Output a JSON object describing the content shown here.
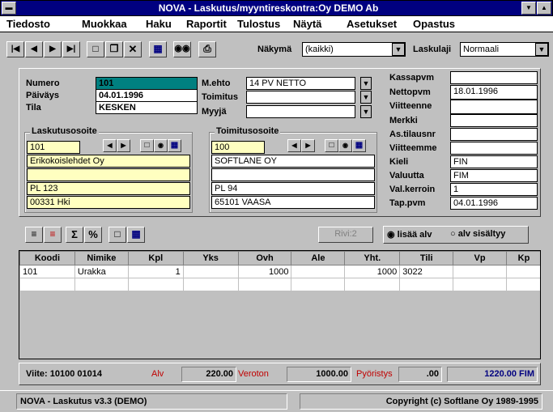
{
  "window": {
    "title": "NOVA - Laskutus/myyntireskontra:Oy DEMO Ab"
  },
  "menu": [
    "Tiedosto",
    "Muokkaa",
    "Haku",
    "Raportit",
    "Tulostus",
    "Näytä",
    "Asetukset",
    "Opastus"
  ],
  "toolbar": {
    "view_label": "Näkymä",
    "view_value": "(kaikki)",
    "type_label": "Laskulaji",
    "type_value": "Normaali"
  },
  "header": {
    "numero_label": "Numero",
    "numero": "101",
    "paivays_label": "Päiväys",
    "paivays": "04.01.1996",
    "tila_label": "Tila",
    "tila": "KESKEN",
    "mehto_label": "M.ehto",
    "mehto": "14 PV NETTO",
    "toimitus_label": "Toimitus",
    "toimitus": "",
    "myyja_label": "Myyjä",
    "myyja": ""
  },
  "billing": {
    "title": "Laskutusosoite",
    "code": "101",
    "lines": [
      "Erikokoislehdet Oy",
      "",
      "PL 123",
      "00331 Hki"
    ]
  },
  "delivery": {
    "title": "Toimitusosoite",
    "code": "100",
    "lines": [
      "SOFTLANE OY",
      "",
      "PL 94",
      "65101  VAASA"
    ]
  },
  "right": [
    {
      "label": "Kassapvm",
      "value": ""
    },
    {
      "label": "Nettopvm",
      "value": "18.01.1996"
    },
    {
      "label": "Viitteenne",
      "value": ""
    },
    {
      "label": "Merkki",
      "value": ""
    },
    {
      "label": "As.tilausnr",
      "value": ""
    },
    {
      "label": "Viitteemme",
      "value": ""
    },
    {
      "label": "Kieli",
      "value": "FIN"
    },
    {
      "label": "Valuutta",
      "value": "FIM"
    },
    {
      "label": "Val.kerroin",
      "value": "1"
    },
    {
      "label": "Tap.pvm",
      "value": "04.01.1996"
    }
  ],
  "rowbar": {
    "rivi": "Rivi:2",
    "opt1": "lisää alv",
    "opt2": "alv sisältyy"
  },
  "grid": {
    "columns": [
      "Koodi",
      "Nimike",
      "Kpl",
      "Yks",
      "Ovh",
      "Ale",
      "Yht.",
      "Tili",
      "Vp",
      "Kp"
    ],
    "rows": [
      [
        "101",
        "Urakka",
        "1",
        "",
        "1000",
        "",
        "1000",
        "3022",
        "",
        ""
      ]
    ]
  },
  "totals": {
    "viite": "Viite: 10100 01014",
    "alv_label": "Alv",
    "alv": "220.00",
    "veroton_label": "Veroton",
    "veroton": "1000.00",
    "pyoristys_label": "Pyöristys",
    "pyoristys": ".00",
    "total": "1220.00 FIM"
  },
  "status": {
    "left": "NOVA - Laskutus v3.3 (DEMO)",
    "right": "Copyright (c) Softlane Oy 1989-1995"
  }
}
